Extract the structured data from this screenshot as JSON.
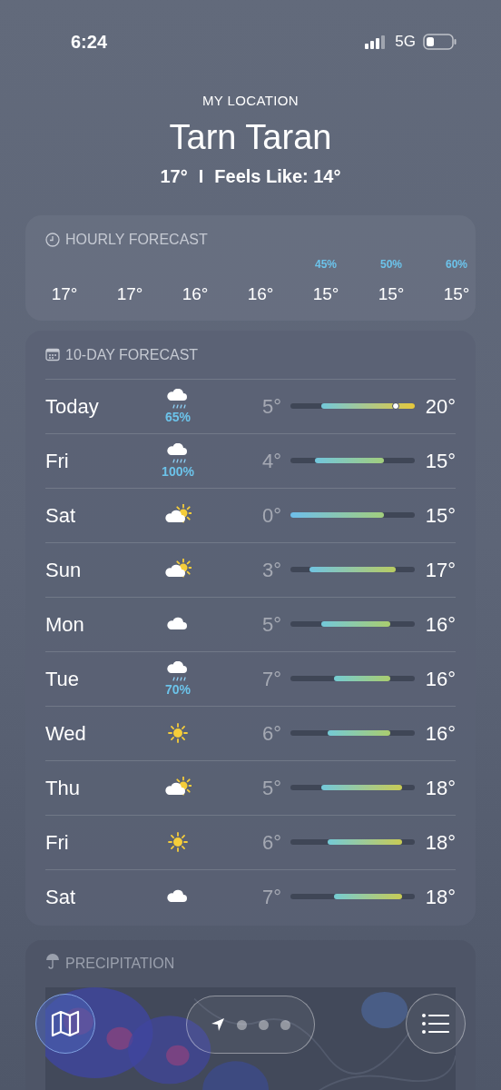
{
  "status_bar": {
    "time": "6:24",
    "network": "5G"
  },
  "header": {
    "subtitle": "MY LOCATION",
    "city": "Tarn Taran",
    "current": "17°",
    "separator": "I",
    "feels_like": "Feels Like: 14°"
  },
  "hourly": {
    "title": "HOURLY FORECAST",
    "hours": [
      {
        "temp": "17°"
      },
      {
        "temp": "17°"
      },
      {
        "temp": "16°"
      },
      {
        "temp": "16°"
      },
      {
        "chance": "45%",
        "temp": "15°"
      },
      {
        "chance": "50%",
        "temp": "15°"
      },
      {
        "chance": "60%",
        "temp": "15°"
      }
    ]
  },
  "daily": {
    "title": "10-DAY FORECAST",
    "days": [
      {
        "day": "Today",
        "kind": "rain",
        "chance": "65%",
        "low": "5°",
        "high": "20°",
        "is_today": true
      },
      {
        "day": "Fri",
        "kind": "rain",
        "chance": "100%",
        "low": "4°",
        "high": "15°",
        "is_today": false
      },
      {
        "day": "Sat",
        "kind": "partly_sunny",
        "low": "0°",
        "high": "15°",
        "is_today": false
      },
      {
        "day": "Sun",
        "kind": "partly_sunny",
        "low": "3°",
        "high": "17°",
        "is_today": false
      },
      {
        "day": "Mon",
        "kind": "cloud",
        "low": "5°",
        "high": "16°",
        "is_today": false
      },
      {
        "day": "Tue",
        "kind": "rain",
        "chance": "70%",
        "low": "7°",
        "high": "16°",
        "is_today": false
      },
      {
        "day": "Wed",
        "kind": "sun",
        "low": "6°",
        "high": "16°",
        "is_today": false
      },
      {
        "day": "Thu",
        "kind": "partly_sunny",
        "low": "5°",
        "high": "18°",
        "is_today": false
      },
      {
        "day": "Fri",
        "kind": "sun",
        "low": "6°",
        "high": "18°",
        "is_today": false
      },
      {
        "day": "Sat",
        "kind": "cloud",
        "low": "7°",
        "high": "18°",
        "is_today": false
      }
    ]
  },
  "precipitation": {
    "title": "PRECIPITATION"
  },
  "toolbar": {
    "pages": [
      {
        "kind": "location",
        "selected": true
      },
      {
        "kind": "dot",
        "selected": false
      },
      {
        "kind": "dot",
        "selected": false
      },
      {
        "kind": "dot",
        "selected": false
      }
    ]
  }
}
